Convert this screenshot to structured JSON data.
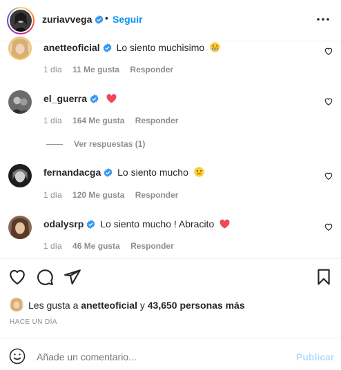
{
  "post_header": {
    "username": "zuriavvega",
    "dot": "•",
    "follow_label": "Seguir"
  },
  "comments": [
    {
      "username": "anetteoficial",
      "text": "Lo siento muchisimo",
      "emoji": "grimacing-face",
      "time": "1 día",
      "likes": "11 Me gusta",
      "reply_label": "Responder"
    },
    {
      "username": "el_guerra",
      "text": "",
      "emoji": "red-heart",
      "time": "1 día",
      "likes": "164 Me gusta",
      "reply_label": "Responder"
    },
    {
      "username": "fernandacga",
      "text": "Lo siento mucho",
      "emoji": "sad-face",
      "time": "1 día",
      "likes": "120 Me gusta",
      "reply_label": "Responder"
    },
    {
      "username": "odalysrp",
      "text": "Lo siento mucho ! Abracito",
      "emoji": "red-heart",
      "time": "1 día",
      "likes": "46 Me gusta",
      "reply_label": "Responder"
    }
  ],
  "view_replies": "Ver respuestas (1)",
  "likes": {
    "prefix": "Les gusta a",
    "user": "anetteoficial",
    "connector": "y",
    "count": "43,650 personas más"
  },
  "date": "HACE UN DÍA",
  "add_comment": {
    "placeholder": "Añade un comentario...",
    "publish_label": "Publicar"
  },
  "colors": {
    "accent": "#0095f6",
    "verified": "#3897f0",
    "heart_red": "#ed4956",
    "muted": "#8e8e8e"
  }
}
